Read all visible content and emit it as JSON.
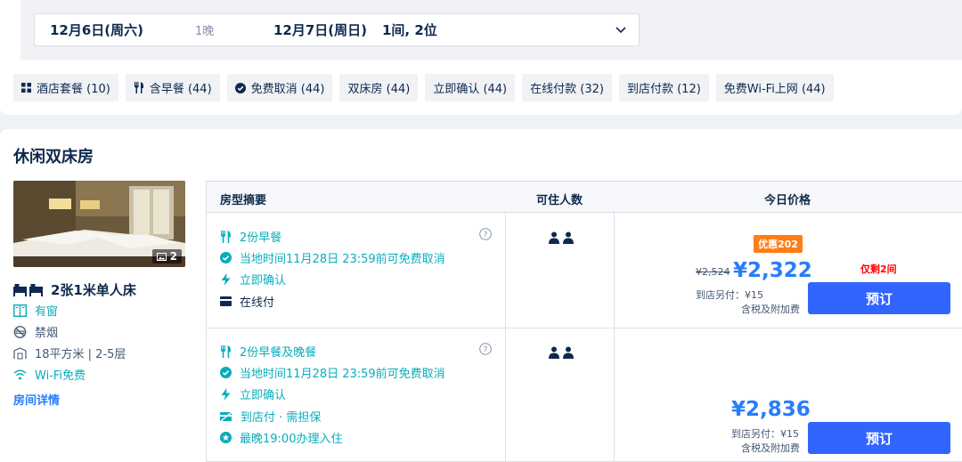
{
  "search": {
    "checkin": "12月6日(周六)",
    "nights": "1晚",
    "checkout": "12月7日(周日)",
    "guests": "1间, 2位"
  },
  "filters": [
    {
      "label": "酒店套餐 (10)",
      "icon": "grid-icon"
    },
    {
      "label": "含早餐 (44)",
      "icon": "cutlery-icon"
    },
    {
      "label": "免费取消 (44)",
      "icon": "check-circle-icon"
    },
    {
      "label": "双床房 (44)"
    },
    {
      "label": "立即确认 (44)"
    },
    {
      "label": "在线付款 (32)"
    },
    {
      "label": "到店付款 (12)"
    },
    {
      "label": "免费Wi-Fi上网 (44)"
    }
  ],
  "room": {
    "title": "休闲双床房",
    "photo_count": "2",
    "bed": "2张1米单人床",
    "features": [
      "有窗",
      "禁烟",
      "18平方米 | 2-5层",
      "Wi-Fi免费"
    ],
    "details_link": "房间详情"
  },
  "table": {
    "headers": [
      "房型摘要",
      "可住人数",
      "今日价格"
    ]
  },
  "offers": [
    {
      "inclusions": [
        "2份早餐",
        "当地时间11月28日 23:59前可免费取消",
        "立即确认",
        "在线付"
      ],
      "badge": "优惠202",
      "old_price": "¥2,524",
      "price": "¥2,322",
      "pay_note_1": "到店另付：¥15",
      "pay_note_2": "含税及附加费",
      "scarcity": "仅剩2间",
      "book": "预订"
    },
    {
      "inclusions": [
        "2份早餐及晚餐",
        "当地时间11月28日 23:59前可免费取消",
        "立即确认",
        "到店付 · 需担保",
        "最晚19:00办理入住"
      ],
      "price": "¥2,836",
      "pay_note_1": "到店另付：¥15",
      "pay_note_2": "含税及附加费",
      "book": "预订"
    }
  ],
  "colors": {
    "accent": "#287dfa",
    "button": "#3264ff",
    "badge": "#ff7d13",
    "green": "#06aebd",
    "scarcity": "#ff0000"
  }
}
